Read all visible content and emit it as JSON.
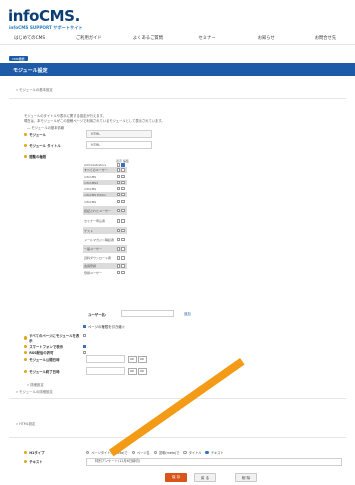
{
  "header": {
    "logo_main": "infoCMS",
    "logo_dot": ".",
    "logo_sub": "infoCMS SUPPORT サポートサイト",
    "nav": [
      "はじめてのCMS",
      "ご利用ガイド",
      "よくあるご質問",
      "セミナー",
      "お知らせ",
      "お問合せ先"
    ]
  },
  "breadcrumb": "CMS機能",
  "page_title": "モジュール設定",
  "sections": {
    "basic_link": "» モジュールの基本設定",
    "details_link": "» モジュールの詳細設定",
    "html_link": "» HTML設定",
    "detail_toggle": "» 詳細設定"
  },
  "description": {
    "line1": "モジュールのタイトルや表示に関する設定が行えます。",
    "line2": "現在は、本モジュールがこの投稿ページで利用されているモジュールとして表示されています。",
    "line3": "— モジュールの基本情報"
  },
  "fields": {
    "module_label": "モジュール",
    "module_value": "HTML",
    "title_label": "モジュール タイトル",
    "title_value": "HTML",
    "perm_label": "閲覧の権限",
    "perm_header": "表示 編集"
  },
  "permissions": [
    {
      "name": "Administrators",
      "shaded": false,
      "c1": false,
      "c2": true
    },
    {
      "name": "すべてのユーザー",
      "shaded": true,
      "c1": false,
      "c2": false
    },
    {
      "name": "infoCMS",
      "shaded": false,
      "c1": false,
      "c2": false
    },
    {
      "name": "infoCMS2",
      "shaded": true,
      "c1": false,
      "c2": false
    },
    {
      "name": "infoCMS",
      "shaded": false,
      "c1": false,
      "c2": false
    },
    {
      "name": "infoCMS Editor",
      "shaded": true,
      "c1": false,
      "c2": false
    },
    {
      "name": "infoCMS",
      "shaded": false,
      "c1": false,
      "c2": false
    },
    {
      "name": "認証されたユーザー",
      "shaded": true,
      "c1": false,
      "c2": false
    },
    {
      "name": "セミナー申込者",
      "shaded": false,
      "c1": false,
      "c2": false
    },
    {
      "name": "ゲスト",
      "shaded": true,
      "c1": false,
      "c2": false
    },
    {
      "name": "メールマガジン購読者",
      "shaded": false,
      "c1": false,
      "c2": false
    },
    {
      "name": "一般ユーザー",
      "shaded": true,
      "c1": false,
      "c2": false
    },
    {
      "name": "資料ダウンロード者",
      "shaded": false,
      "c1": false,
      "c2": false
    },
    {
      "name": "会員登録",
      "shaded": true,
      "c1": false,
      "c2": false
    },
    {
      "name": "登録ユーザー",
      "shaded": false,
      "c1": false,
      "c2": false
    }
  ],
  "user_label": "ユーザー名:",
  "user_button": "追加",
  "page_perm_checkbox": "ページの権限を引き継ぐ",
  "options": [
    {
      "label": "すべてのページにモジュールを表示",
      "checked": false
    },
    {
      "label": "スマートフォンで表示",
      "checked": true
    },
    {
      "label": "RSS配信の許可",
      "checked": false
    },
    {
      "label": "モジュール公開日時",
      "checked": false
    },
    {
      "label": "モジュール終了日時",
      "checked": false
    }
  ],
  "time_selects": {
    "hour": "00",
    "minute": "00"
  },
  "html_type_label": "H1タイプ",
  "html_type_options": [
    {
      "label": "ページタイトル(meta)で",
      "checked": false
    },
    {
      "label": "ページ名",
      "checked": false
    },
    {
      "label": "説明(meta)で",
      "checked": false
    },
    {
      "label": "タイトル",
      "checked": false
    },
    {
      "label": "テキスト",
      "checked": true
    }
  ],
  "text_label": "テキスト",
  "text_value": "特別アンケート(12月6日締切)",
  "buttons": {
    "save": "保 存",
    "back": "戻 る",
    "cancel": "削 除"
  },
  "colors": {
    "brand_blue": "#1d5aa8",
    "accent_orange": "#f39b17",
    "save_orange": "#d9561b",
    "dot_yellow": "#e0a616"
  }
}
